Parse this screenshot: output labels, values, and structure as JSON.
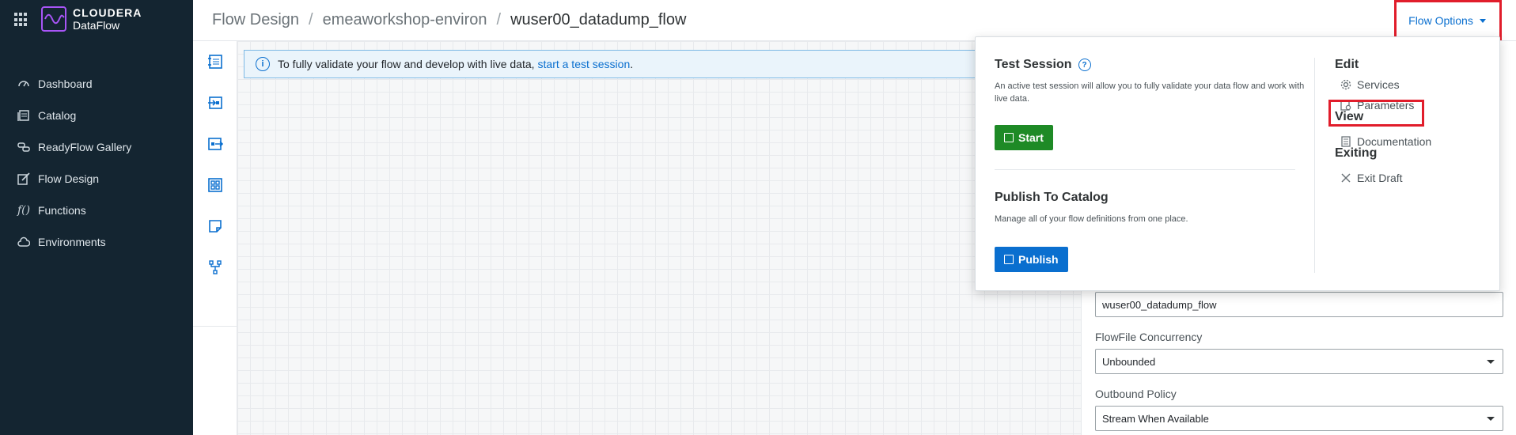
{
  "brand": {
    "line1": "CLOUDERA",
    "line2": "DataFlow"
  },
  "sidebar": {
    "items": [
      {
        "label": "Dashboard",
        "icon": "gauge-icon"
      },
      {
        "label": "Catalog",
        "icon": "catalog-icon"
      },
      {
        "label": "ReadyFlow Gallery",
        "icon": "gallery-icon"
      },
      {
        "label": "Flow Design",
        "icon": "edit-icon"
      },
      {
        "label": "Functions",
        "icon": "function-icon"
      },
      {
        "label": "Environments",
        "icon": "cloud-icon"
      }
    ]
  },
  "breadcrumb": {
    "items": [
      "Flow Design",
      "emeaworkshop-environ",
      "wuser00_datadump_flow"
    ],
    "separator": "/"
  },
  "header": {
    "flow_options_label": "Flow Options"
  },
  "toolbar": {
    "items": [
      "processor-icon",
      "input-port-icon",
      "output-port-icon",
      "process-group-icon",
      "label-icon",
      "funnel-icon"
    ]
  },
  "banner": {
    "text": "To fully validate your flow and develop with live data,",
    "link": "start a test session",
    "suffix": "."
  },
  "menu": {
    "test_session": {
      "title": "Test Session",
      "description": "An active test session will allow you to fully validate your data flow and work with live data.",
      "button": "Start"
    },
    "publish": {
      "title": "Publish To Catalog",
      "description": "Manage all of your flow definitions from one place.",
      "button": "Publish"
    },
    "edit": {
      "title": "Edit",
      "services": "Services",
      "parameters": "Parameters"
    },
    "view": {
      "title": "View",
      "documentation": "Documentation"
    },
    "exiting": {
      "title": "Exiting",
      "exit_draft": "Exit Draft"
    }
  },
  "config": {
    "name_value": "wuser00_datadump_flow",
    "flowfile_concurrency_label": "FlowFile Concurrency",
    "flowfile_concurrency_value": "Unbounded",
    "outbound_policy_label": "Outbound Policy",
    "outbound_policy_value": "Stream When Available"
  },
  "colors": {
    "sidebar_bg": "#142531",
    "accent": "#0a6fcf",
    "start_button": "#1e8a26",
    "highlight": "#e11d2b",
    "logo": "#a855f7"
  }
}
